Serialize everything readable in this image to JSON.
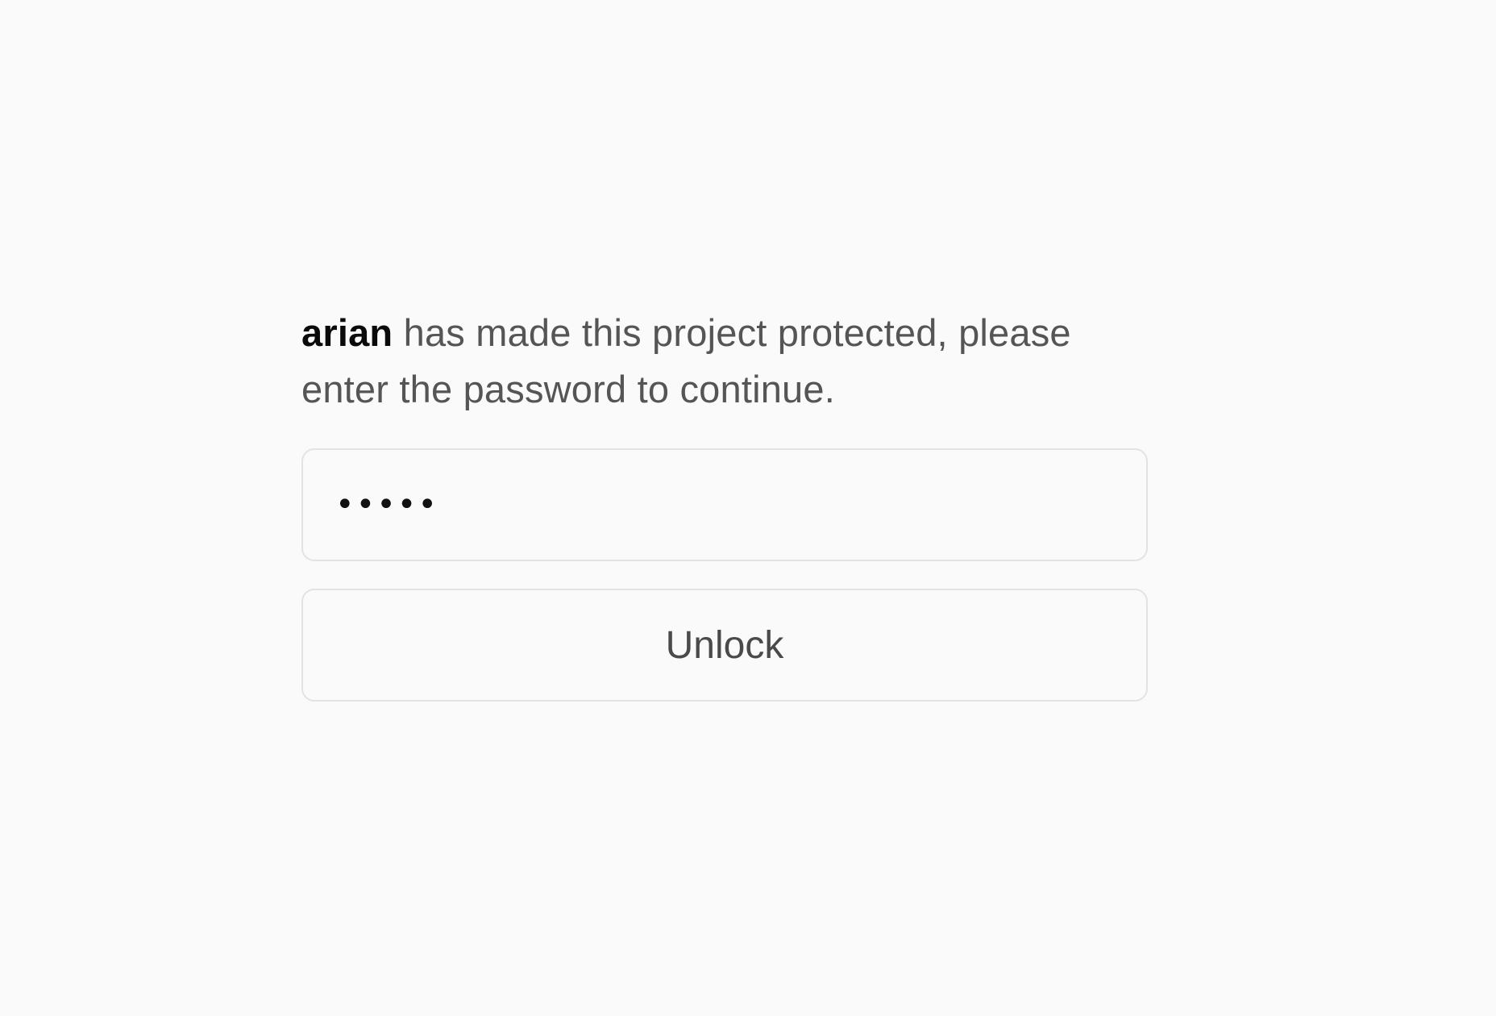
{
  "protect_screen": {
    "owner_name": "arian",
    "message": " has made this project protected, please enter the password to continue.",
    "password_value": "•••••",
    "unlock_label": "Unlock"
  },
  "colors": {
    "background": "#fafafa",
    "owner_text": "#0a0a0a",
    "message_text": "#555555",
    "border": "#e3e3e3"
  }
}
